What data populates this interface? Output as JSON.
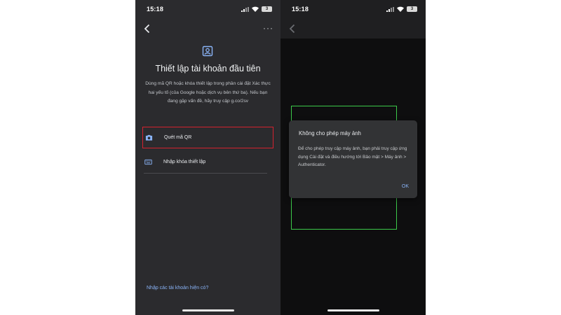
{
  "left_screen": {
    "status": {
      "time": "15:18",
      "battery": "3"
    },
    "title": "Thiết lập tài khoản đầu tiên",
    "description": "Dùng mã QR hoặc khóa thiết lập trong phần cài đặt Xác thực hai yếu tố (của Google hoặc dịch vụ bên thứ ba). Nếu bạn đang gặp vấn đề, hãy truy cập g.co/2sv",
    "options": [
      {
        "label": "Quét mã QR",
        "icon": "camera-icon",
        "highlighted": true
      },
      {
        "label": "Nhập khóa thiết lập",
        "icon": "keyboard-icon",
        "highlighted": false
      }
    ],
    "import_link": "Nhập các tài khoản hiện có?"
  },
  "right_screen": {
    "status": {
      "time": "15:18",
      "battery": "3"
    },
    "dialog": {
      "title": "Không cho phép máy ảnh",
      "body": "Để cho phép truy cập máy ảnh, bạn phải truy cập ứng dụng Cài đặt và điều hướng tới Bảo mật > Máy ảnh > Authenticator.",
      "ok_label": "OK"
    }
  },
  "colors": {
    "highlight_border": "#d4222f",
    "scan_frame": "#3cc94a",
    "link": "#8ab4f8"
  }
}
